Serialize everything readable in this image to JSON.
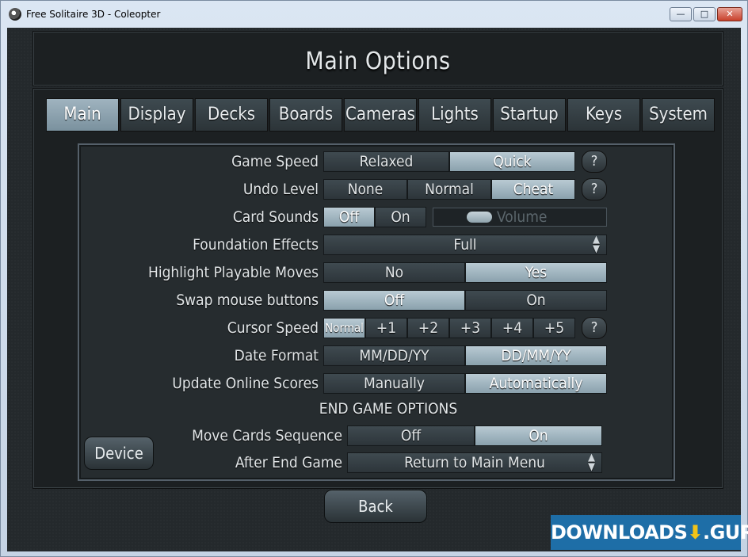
{
  "window": {
    "title": "Free Solitaire 3D - Coleopter",
    "buttons": {
      "minimize": "—",
      "maximize": "□",
      "close": "✕"
    }
  },
  "header": {
    "title": "Main Options"
  },
  "tabs": [
    {
      "label": "Main",
      "active": true
    },
    {
      "label": "Display",
      "active": false
    },
    {
      "label": "Decks",
      "active": false
    },
    {
      "label": "Boards",
      "active": false
    },
    {
      "label": "Cameras",
      "active": false
    },
    {
      "label": "Lights",
      "active": false
    },
    {
      "label": "Startup",
      "active": false
    },
    {
      "label": "Keys",
      "active": false
    },
    {
      "label": "System",
      "active": false
    }
  ],
  "options": {
    "game_speed": {
      "label": "Game Speed",
      "choices": [
        "Relaxed",
        "Quick"
      ],
      "selected": "Quick"
    },
    "undo_level": {
      "label": "Undo Level",
      "choices": [
        "None",
        "Normal",
        "Cheat"
      ],
      "selected": "Cheat"
    },
    "card_sounds": {
      "label": "Card Sounds",
      "choices": [
        "Off",
        "On"
      ],
      "selected": "Off",
      "volume_label": "Volume"
    },
    "foundation_effects": {
      "label": "Foundation Effects",
      "value": "Full"
    },
    "highlight_playable": {
      "label": "Highlight Playable Moves",
      "choices": [
        "No",
        "Yes"
      ],
      "selected": "Yes"
    },
    "swap_mouse": {
      "label": "Swap mouse buttons",
      "choices": [
        "Off",
        "On"
      ],
      "selected": "Off"
    },
    "cursor_speed": {
      "label": "Cursor Speed",
      "choices": [
        "Normal",
        "+1",
        "+2",
        "+3",
        "+4",
        "+5"
      ],
      "selected": "Normal"
    },
    "date_format": {
      "label": "Date Format",
      "choices": [
        "MM/DD/YY",
        "DD/MM/YY"
      ],
      "selected": "DD/MM/YY"
    },
    "update_scores": {
      "label": "Update Online Scores",
      "choices": [
        "Manually",
        "Automatically"
      ],
      "selected": "Automatically"
    }
  },
  "end_game": {
    "heading": "END GAME OPTIONS",
    "move_sequence": {
      "label": "Move Cards Sequence",
      "choices": [
        "Off",
        "On"
      ],
      "selected": "On"
    },
    "after_end": {
      "label": "After End Game",
      "value": "Return to Main Menu"
    }
  },
  "help_label": "?",
  "device_button": "Device",
  "back_button": "Back",
  "watermark": {
    "left": "DOWNLOADS",
    "right": ".GURU"
  }
}
